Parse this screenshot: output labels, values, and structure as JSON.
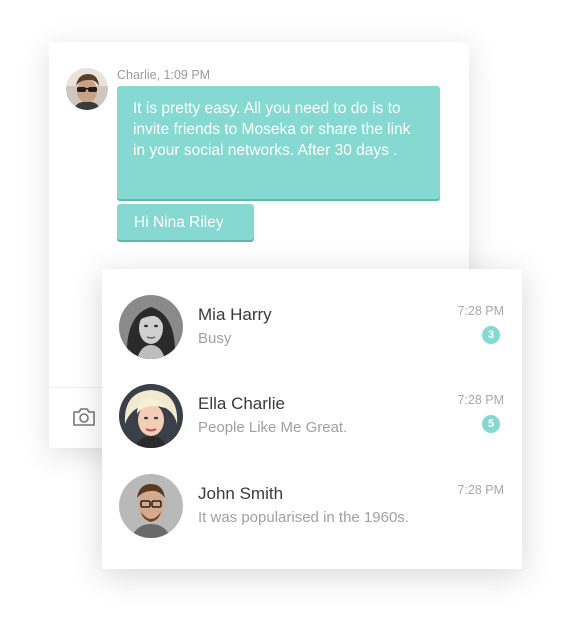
{
  "chat": {
    "sender_meta": "Charlie, 1:09 PM",
    "messages": [
      {
        "text": "It is pretty easy. All you need to do is to invite friends to Moseka or share the link in your social networks. After 30 days ."
      },
      {
        "text": "Hi Nina Riley"
      }
    ],
    "footer": {
      "attach_icon": "camera-icon"
    }
  },
  "contacts": [
    {
      "name": "Mia Harry",
      "status": "Busy",
      "time": "7:28 PM",
      "unread": "3"
    },
    {
      "name": "Ella Charlie",
      "status": "People Like Me Great.",
      "time": "7:28 PM",
      "unread": "5"
    },
    {
      "name": "John Smith",
      "status": "It was popularised in the 1960s.",
      "time": "7:28 PM",
      "unread": null
    }
  ],
  "colors": {
    "accent": "#86d9d1",
    "accent_shadow": "#5fb8ae",
    "text_dark": "#3a3a3a",
    "text_muted": "#a0a0a0"
  }
}
